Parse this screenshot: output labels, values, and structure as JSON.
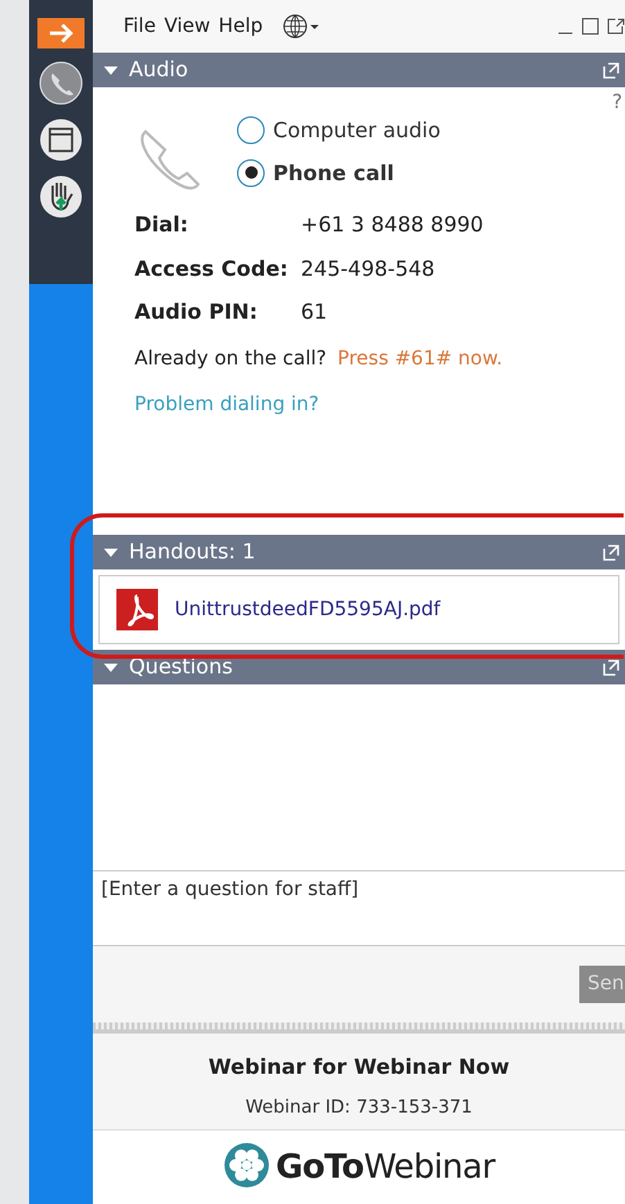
{
  "menu": [
    "File",
    "View",
    "Help"
  ],
  "audio": {
    "title": "Audio",
    "expanded": true,
    "help": "?",
    "options": [
      {
        "label": "Computer audio",
        "selected": false
      },
      {
        "label": "Phone call",
        "selected": true
      }
    ],
    "details": [
      {
        "label": "Dial:",
        "value": "+61 3 8488 8990"
      },
      {
        "label": "Access Code:",
        "value": "245-498-548"
      },
      {
        "label": "Audio PIN:",
        "value": "61"
      }
    ],
    "already": "Already on the call?",
    "press": "Press #61# now.",
    "problem": "Problem dialing in?"
  },
  "handouts": {
    "title": "Handouts: 1",
    "expanded": true,
    "files": [
      "UnittrustdeedFD5595AJ.pdf"
    ]
  },
  "questions": {
    "title": "Questions",
    "expanded": true,
    "placeholder": "[Enter a question for staff]",
    "send": "Sen"
  },
  "webinar": {
    "title": "Webinar for Webinar Now",
    "id": "Webinar ID: 733-153-371",
    "logo": "**GoTo**Webinar"
  }
}
